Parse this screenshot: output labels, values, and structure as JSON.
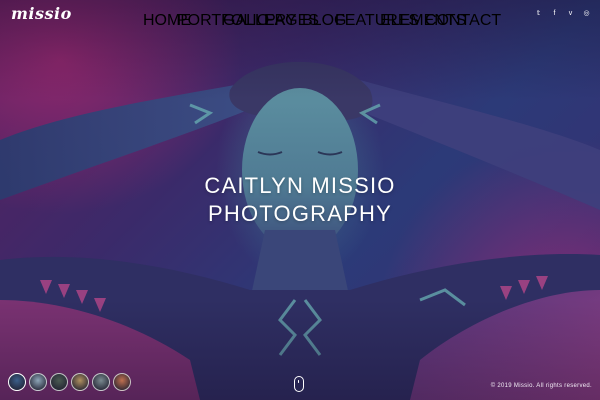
{
  "brand": {
    "logo": "missio"
  },
  "nav": {
    "items": [
      {
        "label": "HOME"
      },
      {
        "label": "PORTFOLIO"
      },
      {
        "label": "GALLERY"
      },
      {
        "label": "PAGES"
      },
      {
        "label": "BLOG"
      },
      {
        "label": "FEATURES"
      },
      {
        "label": "ELEMENTS"
      },
      {
        "label": "CONTACT"
      }
    ]
  },
  "social": {
    "icons": [
      {
        "name": "twitter-icon",
        "glyph": "𝕥"
      },
      {
        "name": "facebook-icon",
        "glyph": "f"
      },
      {
        "name": "vimeo-icon",
        "glyph": "v"
      },
      {
        "name": "instagram-icon",
        "glyph": "◎"
      }
    ]
  },
  "hero": {
    "title_line1": "CAITLYN MISSIO",
    "title_line2": "PHOTOGRAPHY"
  },
  "slider": {
    "thumbnail_count": 6,
    "active_index": 0,
    "thumb_colors": [
      "#3b5f8a",
      "#8ea6b8",
      "#4a5a52",
      "#b09060",
      "#7a8a90",
      "#c07050"
    ]
  },
  "footer": {
    "copyright": "© 2019 Missio. All rights reserved."
  },
  "colors": {
    "accent_magenta": "#c2307a",
    "deep_violet": "#3b2a6a",
    "teal_light": "#5fa8b0"
  }
}
